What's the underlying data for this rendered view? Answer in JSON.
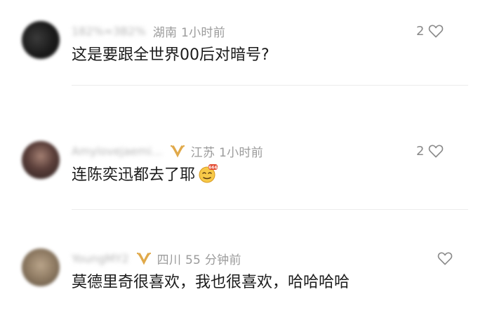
{
  "comments": [
    {
      "username": "182%≈3B2%",
      "location_time": "湖南 1小时前",
      "text": "这是要跟全世界00后对暗号?",
      "likes": "2",
      "has_vip_badge": false,
      "has_emoji": false
    },
    {
      "username": "Amylovejaemi…",
      "location_time": "江苏 1小时前",
      "text": "连陈奕迅都去了耶",
      "likes": "2",
      "has_vip_badge": true,
      "has_emoji": true,
      "emoji_badge": "666"
    },
    {
      "username": "YoungMY2",
      "location_time": "四川 55 分钟前",
      "text": "莫德里奇很喜欢，我也很喜欢，哈哈哈哈",
      "likes": "",
      "has_vip_badge": true,
      "has_emoji": false
    }
  ],
  "icons": {
    "like": "heart-outline-icon",
    "vip": "vip-badge-icon",
    "emoji": "666-emoji-icon"
  },
  "colors": {
    "meta_text": "#9b9b9b",
    "content_text": "#1b1b1b",
    "vip_gold": "#e0a94a",
    "divider": "#ececec"
  }
}
